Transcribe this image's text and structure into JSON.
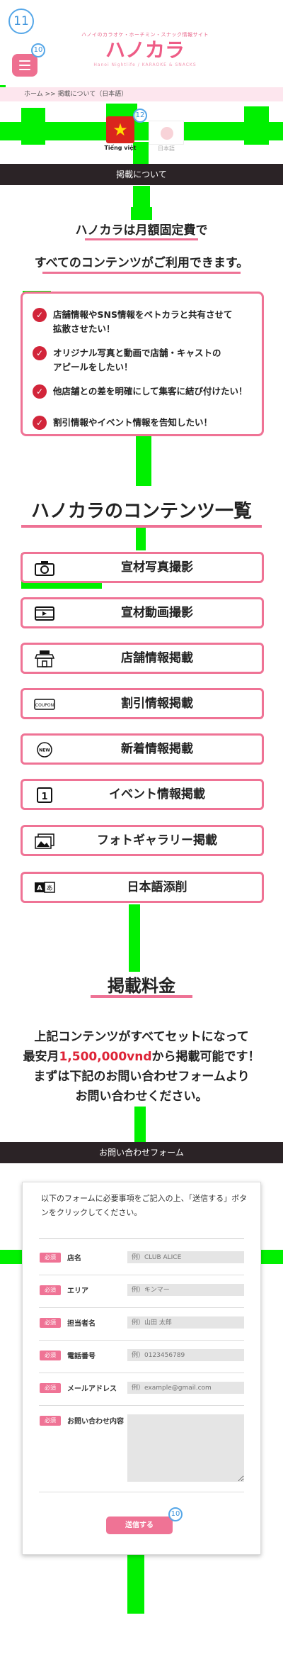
{
  "header": {
    "tagline": "ハノイのカラオケ・ホーチミン・スナック情報サイト",
    "logo": "ハノカラ",
    "logo_sub": "Hanoi Nightlife / KARAOKE & SNACKS",
    "menu_icon": "hamburger-icon"
  },
  "overlay_badges": [
    "11",
    "10",
    "12",
    "10"
  ],
  "breadcrumb": "ホーム >> 掲載について（日本語）",
  "languages": [
    {
      "label": "Tiếng việt",
      "icon": "vietnam-flag-icon",
      "active": true
    },
    {
      "label": "日本語",
      "icon": "japan-flag-icon",
      "active": false
    }
  ],
  "sections": {
    "about": "掲載について",
    "contact": "お問い合わせフォーム"
  },
  "intro": {
    "line1": "ハノカラは月額固定費で",
    "line2": "すべてのコンテンツがご利用できます。"
  },
  "benefits": [
    {
      "line1": "店舗情報やSNS情報をベトカラと共有させて",
      "line2": "拡散させたい！"
    },
    {
      "line1": "オリジナル写真と動画で店舗・キャストの",
      "line2": "アピールをしたい！"
    },
    {
      "line1": "他店舗との差を明確にして集客に結び付けたい！",
      "line2": ""
    },
    {
      "line1": "割引情報やイベント情報を告知したい！",
      "line2": ""
    }
  ],
  "contents_title": "ハノカラのコンテンツ一覧",
  "contents": [
    {
      "label": "宣材写真撮影",
      "icon": "camera-icon"
    },
    {
      "label": "宣材動画撮影",
      "icon": "video-icon"
    },
    {
      "label": "店舗情報掲載",
      "icon": "shop-icon"
    },
    {
      "label": "割引情報掲載",
      "icon": "coupon-icon"
    },
    {
      "label": "新着情報掲載",
      "icon": "new-icon"
    },
    {
      "label": "イベント情報掲載",
      "icon": "event-icon"
    },
    {
      "label": "フォトギャラリー掲載",
      "icon": "gallery-icon"
    },
    {
      "label": "日本語添削",
      "icon": "translate-icon"
    }
  ],
  "fee": {
    "title": "掲載料金",
    "line1": "上記コンテンツがすべてセットになって",
    "line2_prefix": "最安月",
    "price": "1,500,000vnd",
    "line2_suffix": "から掲載可能です！",
    "line3": "まずは下記のお問い合わせフォームより",
    "line4": "お問い合わせください。"
  },
  "form": {
    "intro": "以下のフォームに必要事項をご記入の上、「送信する」ボタンをクリックしてください。",
    "required_label": "必須",
    "fields": [
      {
        "label": "店名",
        "placeholder": "例）CLUB ALICE"
      },
      {
        "label": "エリア",
        "placeholder": "例）キンマー"
      },
      {
        "label": "担当者名",
        "placeholder": "例）山田 太郎"
      },
      {
        "label": "電話番号",
        "placeholder": "例）0123456789"
      },
      {
        "label": "メールアドレス",
        "placeholder": "例）example@gmail.com"
      }
    ],
    "message_label": "お問い合わせ内容",
    "submit": "送信する"
  },
  "colors": {
    "accent_pink": "#ef7395",
    "dark_bar": "#2b2326",
    "check_red": "#d2253a",
    "overlay_green": "#00f000",
    "badge_blue": "#3d93db"
  }
}
